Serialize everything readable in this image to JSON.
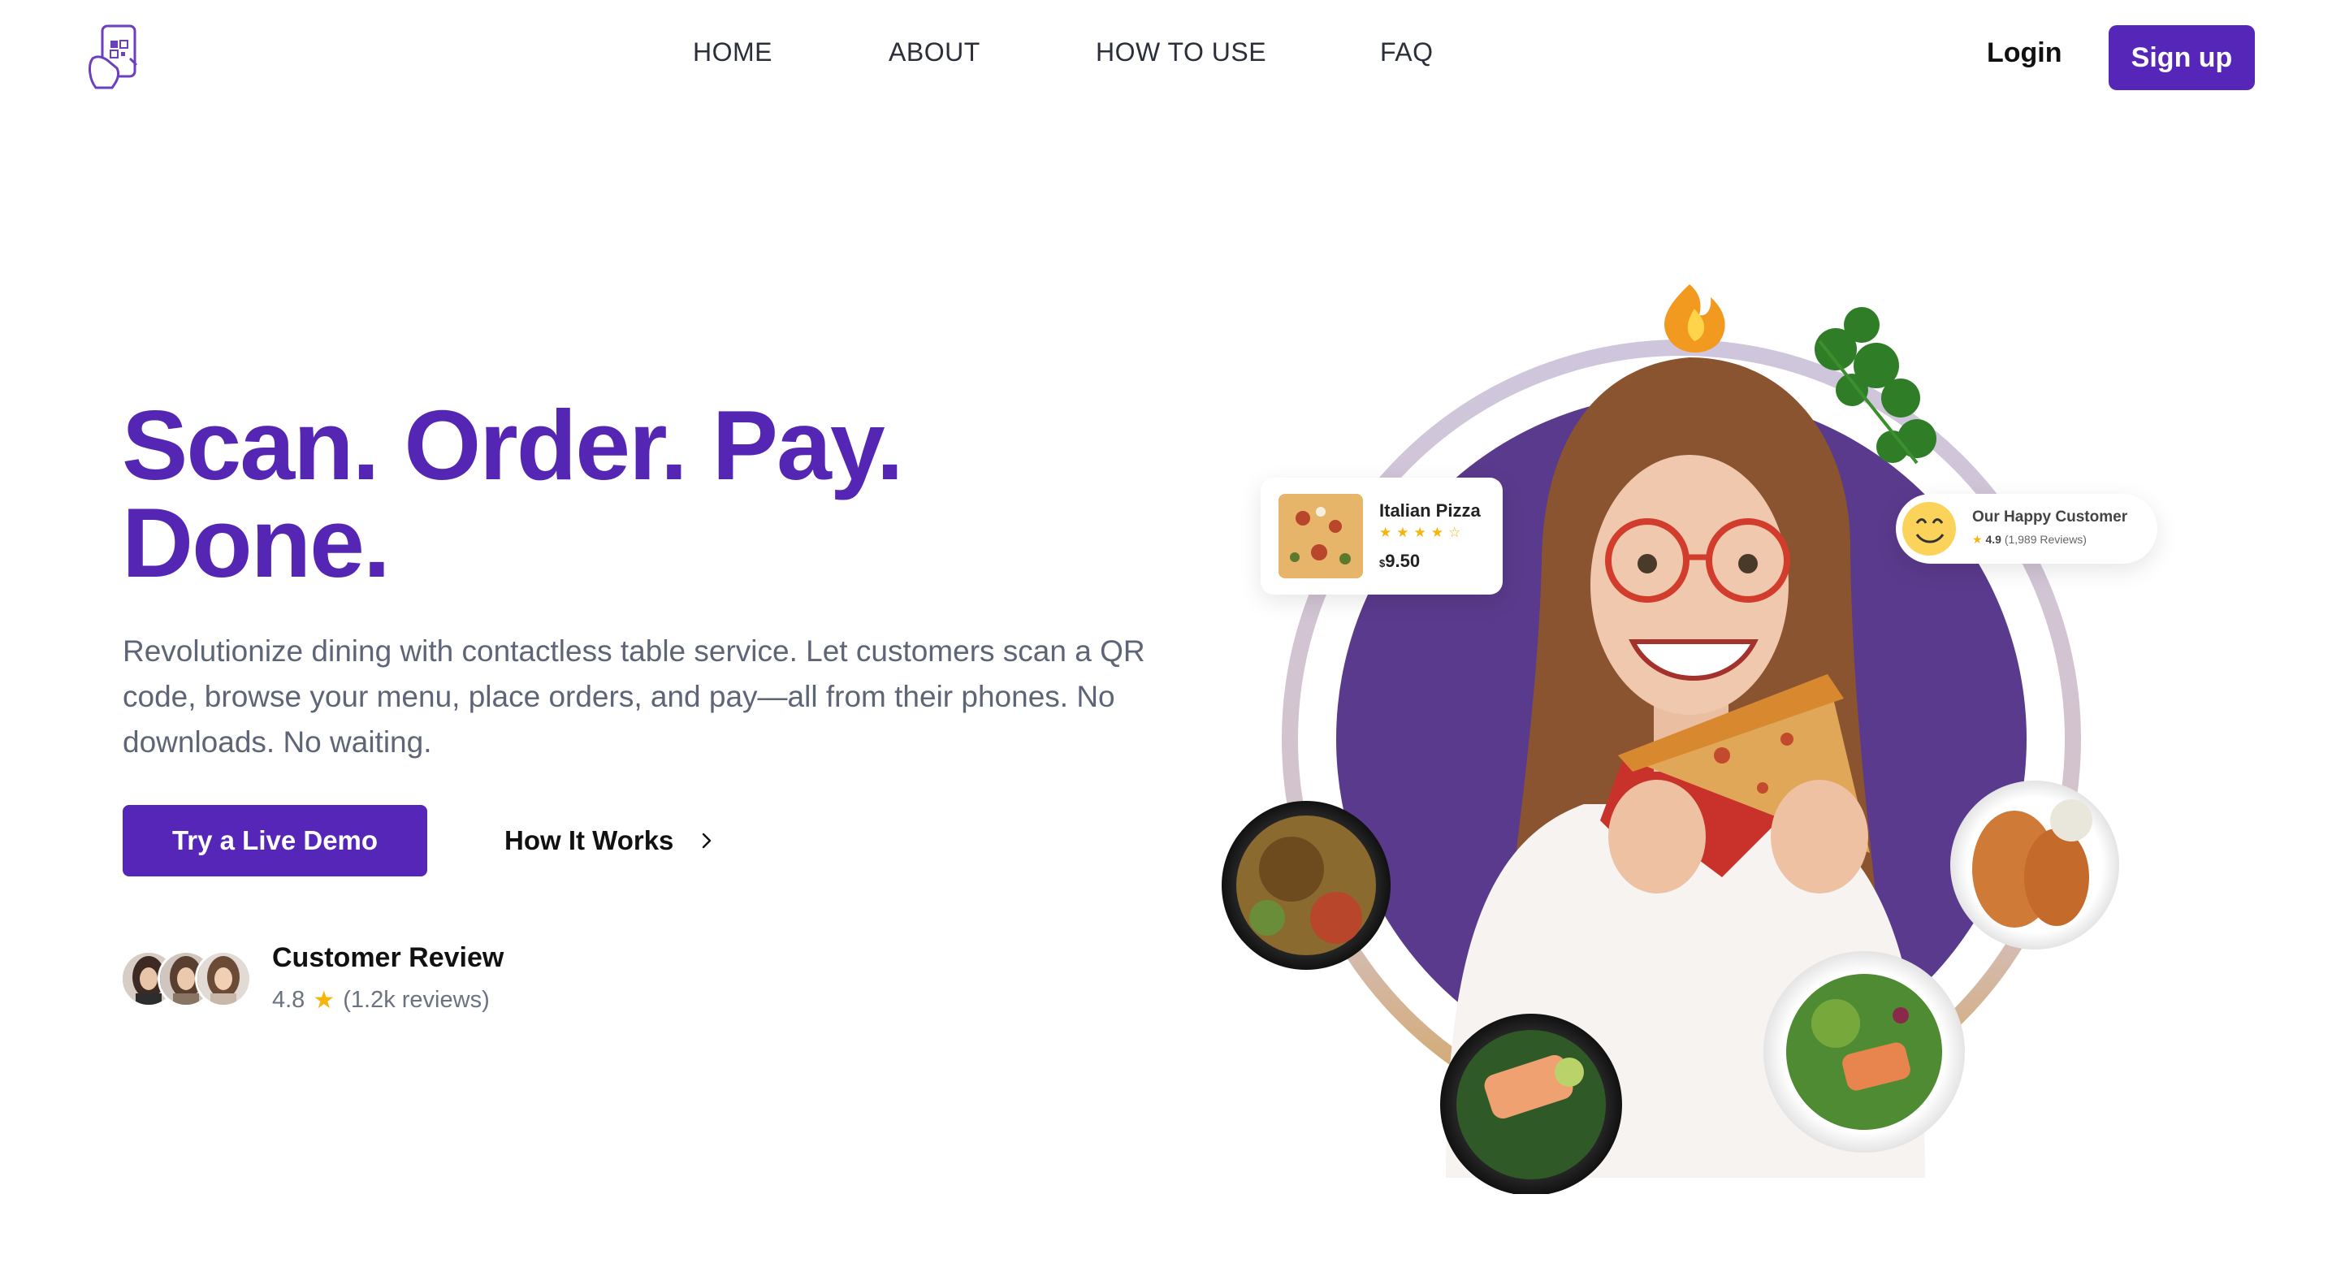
{
  "nav": {
    "logo_icon": "qr-phone-hand-icon",
    "links": [
      "HOME",
      "ABOUT",
      "HOW TO USE",
      "FAQ"
    ],
    "login_label": "Login",
    "signup_label": "Sign up"
  },
  "hero": {
    "headline_line1": "Scan. Order. Pay.",
    "headline_line2": "Done.",
    "subtext": "Revolutionize dining with contactless table service. Let customers scan a QR code, browse your menu, place orders, and pay—all from their phones. No downloads. No waiting.",
    "primary_cta": "Try a Live Demo",
    "secondary_cta": "How It Works",
    "review": {
      "title": "Customer Review",
      "rating": "4.8",
      "count": "(1.2k reviews)"
    }
  },
  "illustration": {
    "pizza_card": {
      "name": "Italian Pizza",
      "stars": "★★★★☆",
      "currency": "$",
      "price": "9.50"
    },
    "customer_card": {
      "title": "Our Happy Customer",
      "rating": "4.9",
      "reviews": "(1,989 Reviews)"
    }
  },
  "colors": {
    "brand": "#5626b8",
    "headline": "#5526b4",
    "body_text": "#5d6577",
    "star": "#f5b50a"
  }
}
